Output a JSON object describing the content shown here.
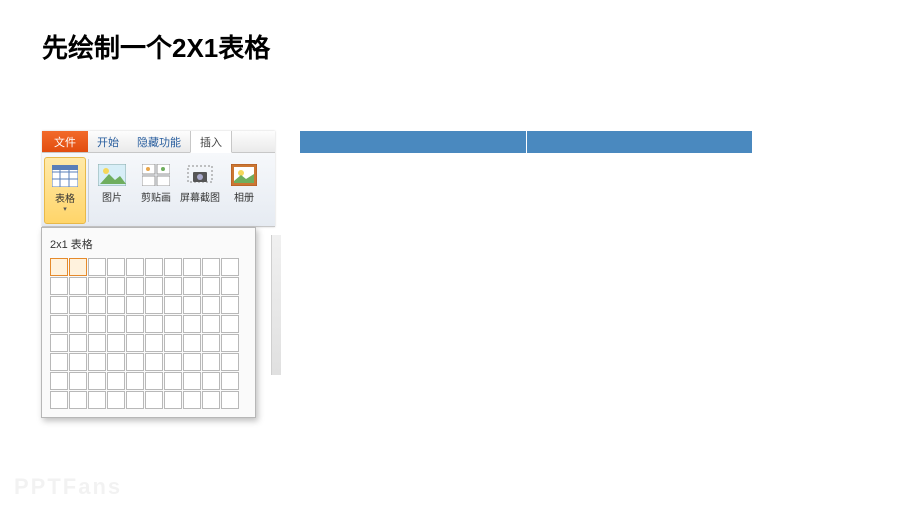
{
  "slide": {
    "title": "先绘制一个2X1表格"
  },
  "ribbon": {
    "tabs": {
      "file": "文件",
      "home": "开始",
      "hidden": "隐藏功能",
      "insert": "插入"
    },
    "buttons": {
      "table": "表格",
      "picture": "图片",
      "clipart": "剪贴画",
      "screenshot": "屏幕截图",
      "album": "相册"
    }
  },
  "dropdown": {
    "title": "2x1 表格",
    "rows": 8,
    "cols": 10,
    "selected_cols": 2,
    "selected_rows": 1
  },
  "result": {
    "cols": 2,
    "rows": 1
  },
  "watermark": "PPTFans"
}
